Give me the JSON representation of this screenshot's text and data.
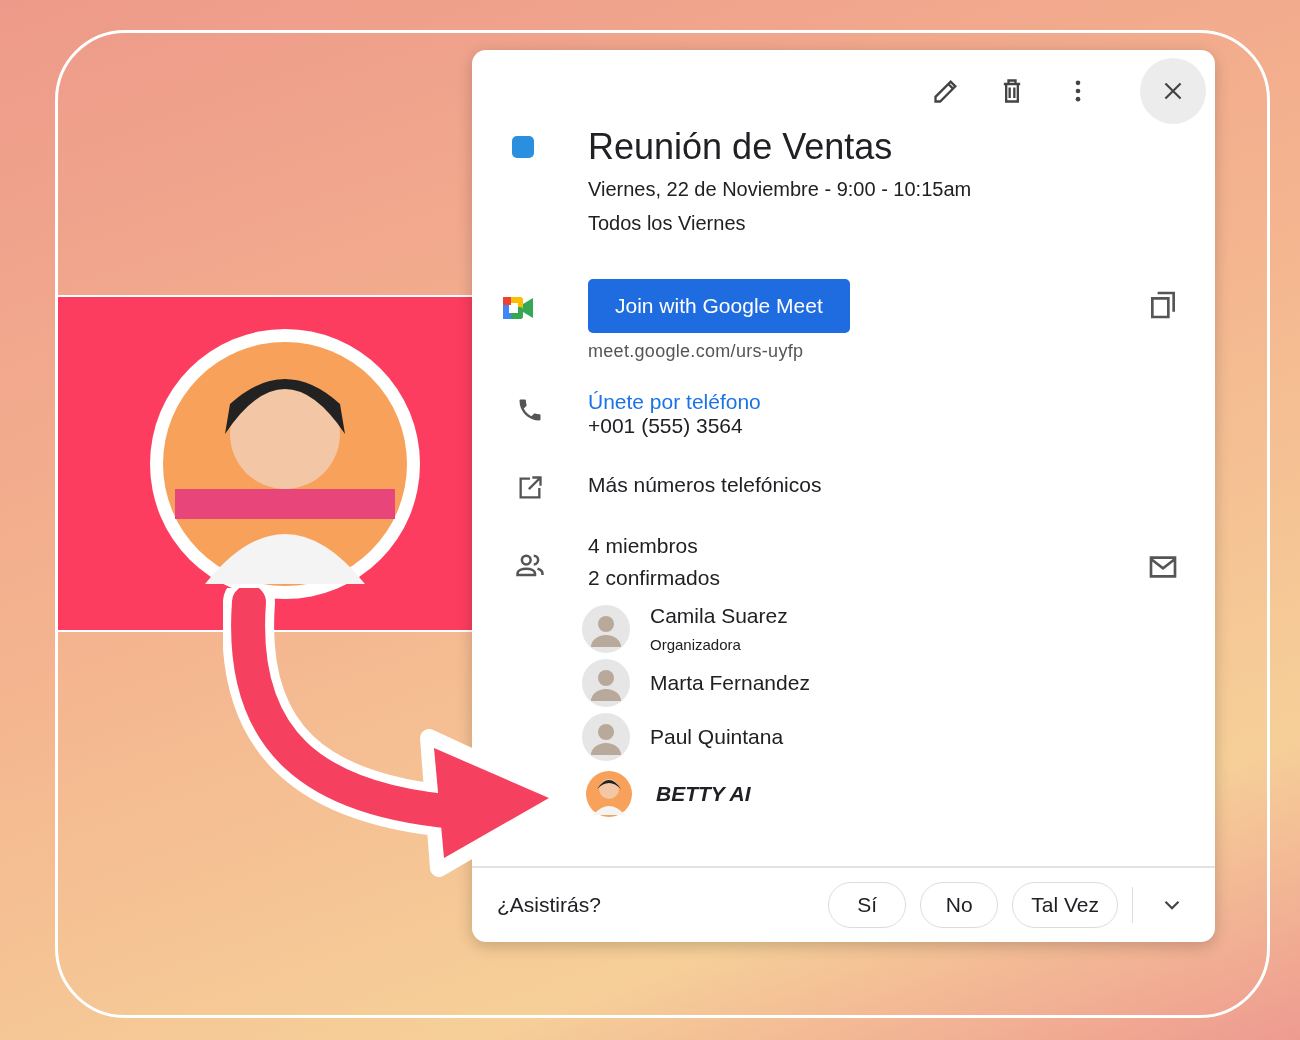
{
  "event": {
    "title": "Reunión de Ventas",
    "date_time": "Viernes, 22 de Noviembre - 9:00 - 10:15am",
    "recurrence": "Todos los Viernes"
  },
  "meet": {
    "button": "Join with Google Meet",
    "link": "meet.google.com/urs-uyfp"
  },
  "phone": {
    "link": "Únete por teléfono",
    "number": "+001 (555) 3564"
  },
  "more_numbers": "Más números telefónicos",
  "guests": {
    "count": "4 miembros",
    "confirmed": "2 confirmados",
    "list": [
      {
        "name": "Camila Suarez",
        "role": "Organizadora",
        "kind": "person"
      },
      {
        "name": "Marta Fernandez",
        "kind": "person"
      },
      {
        "name": "Paul Quintana",
        "kind": "person"
      },
      {
        "name": "BETTY AI",
        "kind": "bot"
      }
    ]
  },
  "rsvp": {
    "question": "¿Asistirás?",
    "options": [
      "Sí",
      "No",
      "Tal Vez"
    ]
  }
}
